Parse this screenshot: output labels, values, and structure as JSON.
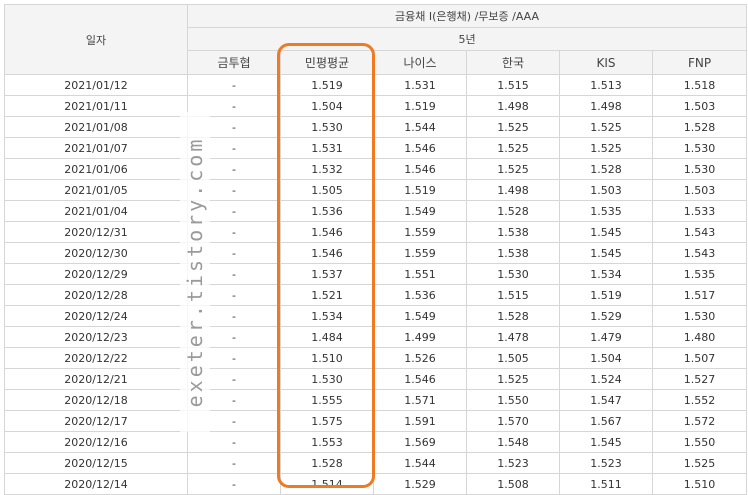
{
  "header": {
    "date_col": "일자",
    "group": "금융채 I(은행채) /무보증 /AAA",
    "period": "5년",
    "columns": [
      "금투협",
      "민평평균",
      "나이스",
      "한국",
      "KIS",
      "FNP"
    ]
  },
  "rows": [
    [
      "2021/01/12",
      "-",
      "1.519",
      "1.531",
      "1.515",
      "1.513",
      "1.518"
    ],
    [
      "2021/01/11",
      "-",
      "1.504",
      "1.519",
      "1.498",
      "1.498",
      "1.503"
    ],
    [
      "2021/01/08",
      "-",
      "1.530",
      "1.544",
      "1.525",
      "1.525",
      "1.528"
    ],
    [
      "2021/01/07",
      "-",
      "1.531",
      "1.546",
      "1.525",
      "1.525",
      "1.530"
    ],
    [
      "2021/01/06",
      "-",
      "1.532",
      "1.546",
      "1.525",
      "1.528",
      "1.530"
    ],
    [
      "2021/01/05",
      "-",
      "1.505",
      "1.519",
      "1.498",
      "1.503",
      "1.503"
    ],
    [
      "2021/01/04",
      "-",
      "1.536",
      "1.549",
      "1.528",
      "1.535",
      "1.533"
    ],
    [
      "2020/12/31",
      "-",
      "1.546",
      "1.559",
      "1.538",
      "1.545",
      "1.543"
    ],
    [
      "2020/12/30",
      "-",
      "1.546",
      "1.559",
      "1.538",
      "1.545",
      "1.543"
    ],
    [
      "2020/12/29",
      "-",
      "1.537",
      "1.551",
      "1.530",
      "1.534",
      "1.535"
    ],
    [
      "2020/12/28",
      "-",
      "1.521",
      "1.536",
      "1.515",
      "1.519",
      "1.517"
    ],
    [
      "2020/12/24",
      "-",
      "1.534",
      "1.549",
      "1.528",
      "1.529",
      "1.530"
    ],
    [
      "2020/12/23",
      "-",
      "1.484",
      "1.499",
      "1.478",
      "1.479",
      "1.480"
    ],
    [
      "2020/12/22",
      "-",
      "1.510",
      "1.526",
      "1.505",
      "1.504",
      "1.507"
    ],
    [
      "2020/12/21",
      "-",
      "1.530",
      "1.546",
      "1.525",
      "1.524",
      "1.527"
    ],
    [
      "2020/12/18",
      "-",
      "1.555",
      "1.571",
      "1.550",
      "1.547",
      "1.552"
    ],
    [
      "2020/12/17",
      "-",
      "1.575",
      "1.591",
      "1.570",
      "1.567",
      "1.572"
    ],
    [
      "2020/12/16",
      "-",
      "1.553",
      "1.569",
      "1.548",
      "1.545",
      "1.550"
    ],
    [
      "2020/12/15",
      "-",
      "1.528",
      "1.544",
      "1.523",
      "1.523",
      "1.525"
    ],
    [
      "2020/12/14",
      "-",
      "1.514",
      "1.529",
      "1.508",
      "1.511",
      "1.510"
    ]
  ],
  "watermark": "exeter.tistory.com",
  "highlight_color": "#f07a22"
}
